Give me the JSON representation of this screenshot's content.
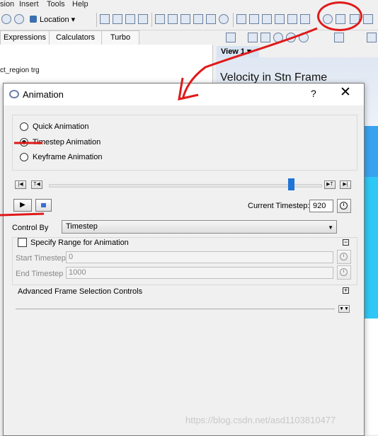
{
  "menubar": {
    "items": [
      "sion",
      "Insert",
      "Tools",
      "Help"
    ]
  },
  "toolbar": {
    "location_label": "Location"
  },
  "panel_tabs": [
    "Expressions",
    "Calculators",
    "Turbo"
  ],
  "left_panel": {
    "visible_text": "ct_region trg"
  },
  "view": {
    "tab_label": "View 1",
    "viewport_title": "Velocity in Stn Frame"
  },
  "dialog": {
    "title": "Animation",
    "help_glyph": "?",
    "close_glyph": "✕",
    "modes": [
      {
        "label": "Quick Animation",
        "selected": false
      },
      {
        "label": "Timestep Animation",
        "selected": true
      },
      {
        "label": "Keyframe Animation",
        "selected": false
      }
    ],
    "slider_position": 0.89,
    "current_timestep_label": "Current Timestep:",
    "current_timestep_value": "920",
    "control_by_label": "Control By",
    "control_by_value": "Timestep",
    "specify_range_label": "Specify Range for Animation",
    "specify_range_checked": false,
    "start_label": "Start Timestep",
    "start_value": "0",
    "end_label": "End Timestep",
    "end_value": "1000",
    "advanced_label": "Advanced Frame Selection Controls"
  },
  "watermark": "https://blog.csdn.net/asd1103810477",
  "colors": {
    "annotation_red": "#e01a1a",
    "accent_blue": "#1f74d6"
  }
}
